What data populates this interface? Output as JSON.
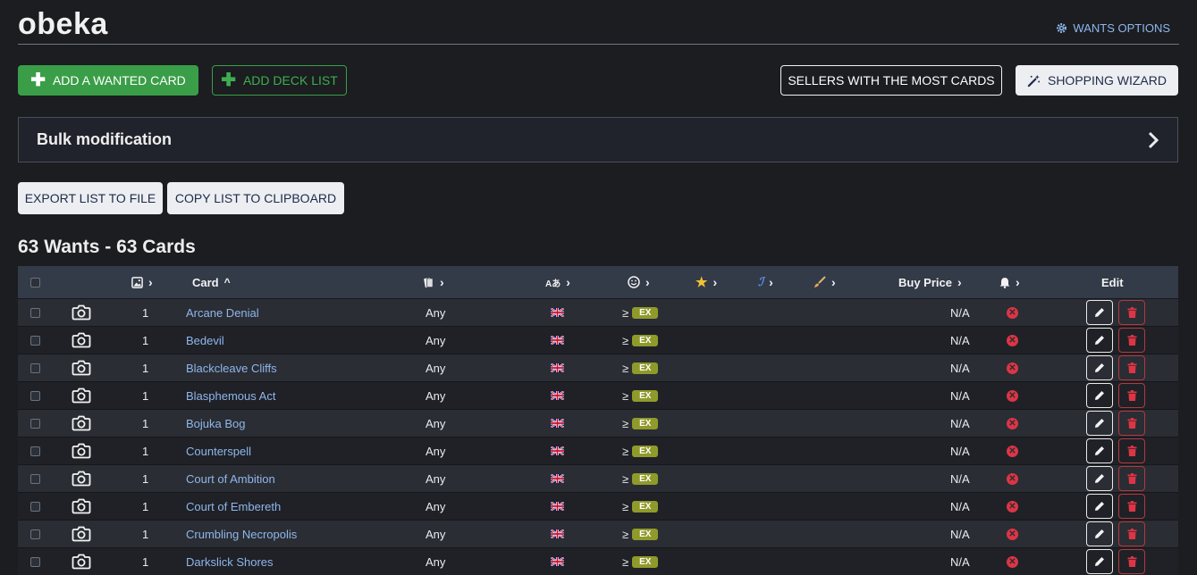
{
  "header": {
    "title": "obeka",
    "options_label": "WANTS OPTIONS",
    "options_icon": "gear-icon"
  },
  "toolbar": {
    "add_wanted_label": "ADD A WANTED CARD",
    "add_deck_label": "ADD DECK LIST",
    "sellers_label": "SELLERS WITH THE MOST CARDS",
    "wizard_label": "SHOPPING WIZARD",
    "wizard_icon": "magic-wand-icon"
  },
  "bulk": {
    "title": "Bulk modification"
  },
  "export": {
    "export_label": "EXPORT LIST TO FILE",
    "copy_label": "COPY LIST TO CLIPBOARD"
  },
  "summary": {
    "heading": "63 Wants - 63 Cards"
  },
  "table": {
    "columns": {
      "quantity_icon": "image-icon",
      "card": "Card",
      "expansion_icon": "cards-icon",
      "language_icon": "language-icon",
      "condition_icon": "smile-icon",
      "foil_icon": "star-icon",
      "signed_icon": "signed-icon",
      "altered_icon": "brush-icon",
      "buy_price": "Buy Price",
      "alert_icon": "bell-icon",
      "edit": "Edit"
    },
    "rows": [
      {
        "qty": "1",
        "name": "Arcane Denial",
        "expansion": "Any",
        "condition": "EX",
        "condition_prefix": "≥",
        "price": "N/A"
      },
      {
        "qty": "1",
        "name": "Bedevil",
        "expansion": "Any",
        "condition": "EX",
        "condition_prefix": "≥",
        "price": "N/A"
      },
      {
        "qty": "1",
        "name": "Blackcleave Cliffs",
        "expansion": "Any",
        "condition": "EX",
        "condition_prefix": "≥",
        "price": "N/A"
      },
      {
        "qty": "1",
        "name": "Blasphemous Act",
        "expansion": "Any",
        "condition": "EX",
        "condition_prefix": "≥",
        "price": "N/A"
      },
      {
        "qty": "1",
        "name": "Bojuka Bog",
        "expansion": "Any",
        "condition": "EX",
        "condition_prefix": "≥",
        "price": "N/A"
      },
      {
        "qty": "1",
        "name": "Counterspell",
        "expansion": "Any",
        "condition": "EX",
        "condition_prefix": "≥",
        "price": "N/A"
      },
      {
        "qty": "1",
        "name": "Court of Ambition",
        "expansion": "Any",
        "condition": "EX",
        "condition_prefix": "≥",
        "price": "N/A"
      },
      {
        "qty": "1",
        "name": "Court of Embereth",
        "expansion": "Any",
        "condition": "EX",
        "condition_prefix": "≥",
        "price": "N/A"
      },
      {
        "qty": "1",
        "name": "Crumbling Necropolis",
        "expansion": "Any",
        "condition": "EX",
        "condition_prefix": "≥",
        "price": "N/A"
      },
      {
        "qty": "1",
        "name": "Darkslick Shores",
        "expansion": "Any",
        "condition": "EX",
        "condition_prefix": "≥",
        "price": "N/A"
      }
    ]
  },
  "colors": {
    "background": "#1b1d21",
    "accent_green": "#3a9e48",
    "link_blue": "#8fb6ec",
    "header_row": "#333a48",
    "danger_red": "#dc3545",
    "badge_olive": "#8f9a2b"
  }
}
